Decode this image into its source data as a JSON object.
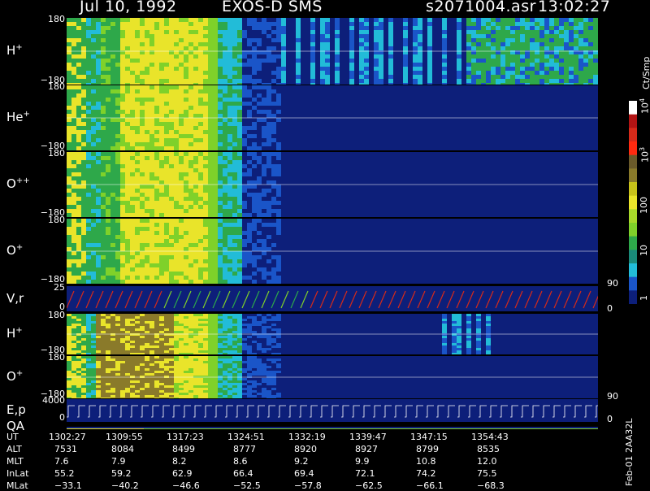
{
  "header": {
    "date": "Jul 10, 1992",
    "instrument": "EXOS-D SMS",
    "file": "s2071004.asr",
    "time": "13:02:27"
  },
  "colors": {
    "background": "#000000",
    "bg_dark": "#0d1f7a",
    "mid_blue": "#1a55c8",
    "cyan": "#22bcd8",
    "green": "#2ea84a",
    "lime": "#7fd12a",
    "yellow": "#e9e42a",
    "olive": "#8a7a2a",
    "red": "#d62a1a"
  },
  "panels": [
    {
      "id": "h_plus",
      "label": "H",
      "sup": "+",
      "ymax": "180",
      "ymin": "−180"
    },
    {
      "id": "he_plus",
      "label": "He",
      "sup": "+",
      "ymax": "180",
      "ymin": "−180"
    },
    {
      "id": "o_pp",
      "label": "O",
      "sup": "++",
      "ymax": "180",
      "ymin": "−180"
    },
    {
      "id": "o_plus",
      "label": "O",
      "sup": "+",
      "ymax": "180",
      "ymin": "−180"
    },
    {
      "id": "vr",
      "label": "V,r",
      "sup": "",
      "ymax": "25",
      "ymin": "0",
      "rtop": "90",
      "rbot": "0"
    },
    {
      "id": "h_plus2",
      "label": "H",
      "sup": "+",
      "ymax": "180",
      "ymin": "−180"
    },
    {
      "id": "o_plus2",
      "label": "O",
      "sup": "+",
      "ymax": "180",
      "ymin": "−180"
    },
    {
      "id": "ep",
      "label": "E,p",
      "sup": "",
      "ymax": "4000",
      "ymin": "0",
      "rtop": "90",
      "rbot": "0"
    },
    {
      "id": "qa",
      "label": "QA",
      "sup": ""
    }
  ],
  "colorbar": {
    "unit": "Ct/Smp",
    "ticks": [
      "10",
      "10",
      "100",
      "10",
      "1"
    ],
    "tick_exp": [
      "4",
      "3",
      "",
      "",
      ""
    ]
  },
  "chart_data": {
    "type": "heatmap",
    "title": "Jul 10, 1992   EXOS-D SMS",
    "x_labels": [
      "1302:27",
      "1309:55",
      "1317:23",
      "1324:51",
      "1332:19",
      "1339:47",
      "1347:15",
      "1354:43"
    ],
    "rows": [
      {
        "name": "UT",
        "values": [
          "1302:27",
          "1309:55",
          "1317:23",
          "1324:51",
          "1332:19",
          "1339:47",
          "1347:15",
          "1354:43"
        ]
      },
      {
        "name": "ALT",
        "values": [
          "7531",
          "8084",
          "8499",
          "8777",
          "8920",
          "8927",
          "8799",
          "8535"
        ]
      },
      {
        "name": "MLT",
        "values": [
          "7.6",
          "7.9",
          "8.2",
          "8.6",
          "9.2",
          "9.9",
          "10.8",
          "12.0"
        ]
      },
      {
        "name": "InLat",
        "values": [
          "55.2",
          "59.2",
          "62.9",
          "66.4",
          "69.4",
          "72.1",
          "74.2",
          "75.5"
        ]
      },
      {
        "name": "MLat",
        "values": [
          "−33.1",
          "−40.2",
          "−46.6",
          "−52.5",
          "−57.8",
          "−62.5",
          "−66.1",
          "−68.3"
        ]
      }
    ],
    "colorbar_range": [
      1,
      10000
    ],
    "colorbar_scale": "log"
  },
  "footer": {
    "stamp": "Feb-01 2AA32L"
  }
}
